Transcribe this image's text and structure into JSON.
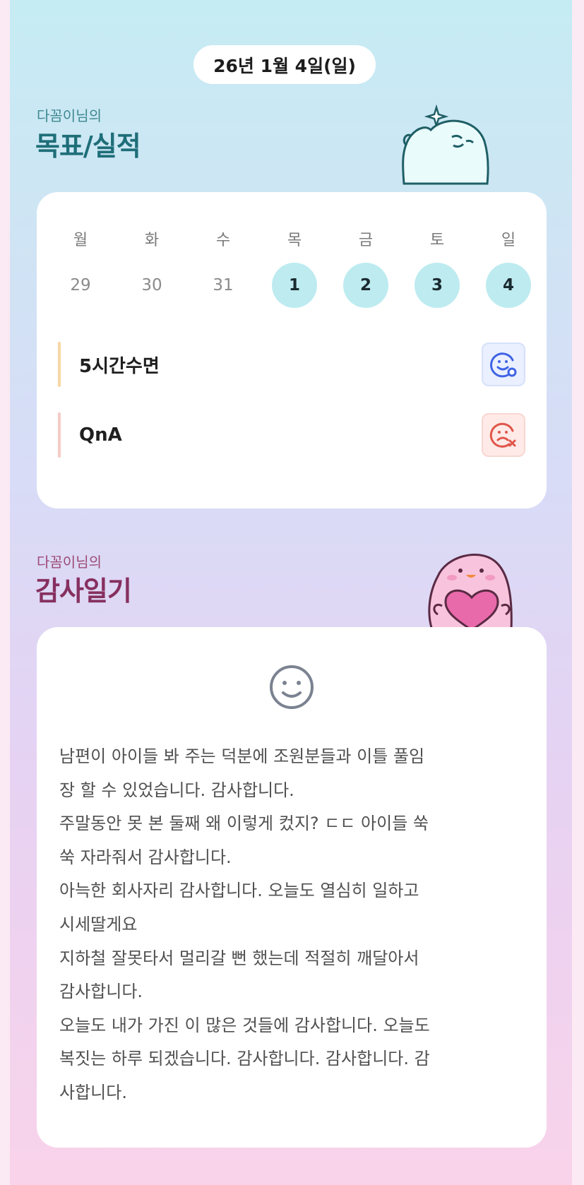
{
  "header": {
    "date": "26년 1월 4일(일)"
  },
  "goals_section": {
    "subtitle": "다꼼이님의",
    "title": "목표/실적",
    "weekdays": [
      "월",
      "화",
      "수",
      "목",
      "금",
      "토",
      "일"
    ],
    "days": [
      "29",
      "30",
      "31",
      "1",
      "2",
      "3",
      "4"
    ],
    "items": [
      {
        "label": "5시간수면",
        "status_icon": "happy-face-icon",
        "bar_color": "#f6d6a4"
      },
      {
        "label": "QnA",
        "status_icon": "sad-face-x-icon",
        "bar_color": "#f5cbc6"
      }
    ]
  },
  "diary_section": {
    "subtitle": "다꼼이님의",
    "title": "감사일기",
    "icon": "smile-icon",
    "text": "남편이 아이들 봐 주는 덕분에 조원분들과 이틀 풀임\n장 할 수 있었습니다. 감사합니다.\n주말동안 못 본 둘째 왜 이렇게 컸지? ㄷㄷ 아이들 쑥\n쑥 자라줘서 감사합니다.\n아늑한 회사자리 감사합니다. 오늘도 열심히 일하고\n시세딸게요\n지하철 잘못타서 멀리갈 뻔 했는데 적절히 깨달아서\n감사합니다.\n오늘도 내가 가진 이 많은 것들에 감사합니다. 오늘도\n복짓는 하루 되겠습니다. 감사합니다. 감사합니다. 감\n사합니다."
  },
  "colors": {
    "goals_title": "#1e6e78",
    "goals_subtitle": "#3d8790",
    "diary_title": "#86305f",
    "diary_subtitle": "#9c4a76",
    "active_day": "#bdebf0"
  }
}
